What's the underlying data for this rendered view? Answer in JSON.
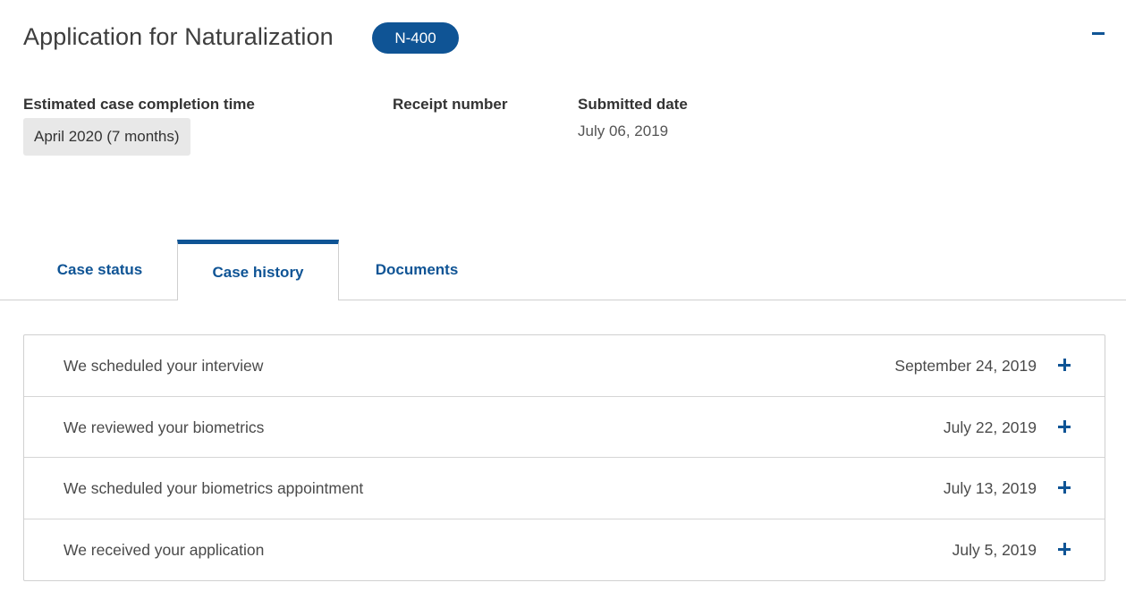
{
  "case": {
    "title": "Application for Naturalization",
    "form_badge": "N-400",
    "collapse_icon": "minus-icon"
  },
  "fields": {
    "estimated_label": "Estimated case completion time",
    "estimated_value": "April 2020 (7 months)",
    "receipt_label": "Receipt number",
    "receipt_value": "",
    "submitted_label": "Submitted date",
    "submitted_value": "July 06, 2019"
  },
  "tabs": [
    {
      "label": "Case status",
      "active": false
    },
    {
      "label": "Case history",
      "active": true
    },
    {
      "label": "Documents",
      "active": false
    }
  ],
  "history": [
    {
      "title": "We scheduled your interview",
      "date": "September 24, 2019",
      "icon": "plus-icon"
    },
    {
      "title": "We reviewed your biometrics",
      "date": "July 22, 2019",
      "icon": "plus-icon"
    },
    {
      "title": "We scheduled your biometrics appointment",
      "date": "July 13, 2019",
      "icon": "plus-icon"
    },
    {
      "title": "We received your application",
      "date": "July 5, 2019",
      "icon": "plus-icon"
    }
  ],
  "colors": {
    "accent": "#0f5495",
    "chip_bg": "#e8e8e8",
    "border": "#d0d0d0"
  }
}
